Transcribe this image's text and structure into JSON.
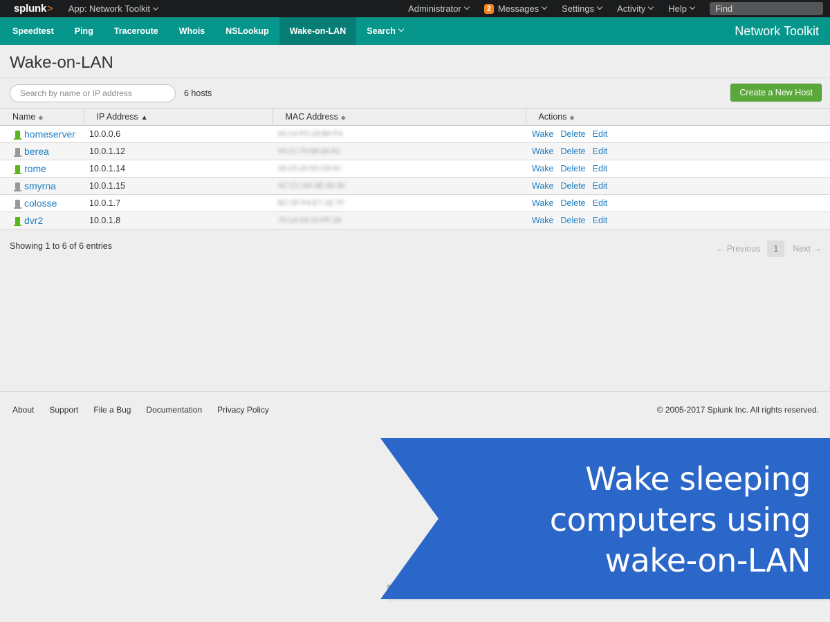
{
  "topbar": {
    "logo": "splunk",
    "logo_mark": ">",
    "app_menu": "App: Network Toolkit",
    "user": "Administrator",
    "messages_count": "2",
    "messages": "Messages",
    "settings": "Settings",
    "activity": "Activity",
    "help": "Help",
    "find_placeholder": "Find"
  },
  "nav": {
    "items": [
      "Speedtest",
      "Ping",
      "Traceroute",
      "Whois",
      "NSLookup",
      "Wake-on-LAN",
      "Search"
    ],
    "active": "Wake-on-LAN",
    "app_title": "Network Toolkit"
  },
  "page": {
    "title": "Wake-on-LAN",
    "search_placeholder": "Search by name or IP address",
    "host_count": "6 hosts",
    "new_host_button": "Create a New Host"
  },
  "table": {
    "columns": [
      "Name",
      "IP Address",
      "MAC Address",
      "Actions"
    ],
    "rows": [
      {
        "name": "homeserver",
        "ip": "10.0.0.6",
        "mac": "00:14:FD:18:B0:F4",
        "online": true
      },
      {
        "name": "berea",
        "ip": "10.0.1.12",
        "mac": "00:21:70:08:3A:61",
        "online": false
      },
      {
        "name": "rome",
        "ip": "10.0.1.14",
        "mac": "00:23:24:55:C8:4C",
        "online": true
      },
      {
        "name": "smyrna",
        "ip": "10.0.1.15",
        "mac": "4C:CC:6A:4E:40:30",
        "online": false
      },
      {
        "name": "colosse",
        "ip": "10.0.1.7",
        "mac": "BC:5F:F4:E7:1E:7F",
        "online": false
      },
      {
        "name": "dvr2",
        "ip": "10.0.1.8",
        "mac": "70:1A:04:10:FF:28",
        "online": true
      }
    ],
    "actions": {
      "wake": "Wake",
      "delete": "Delete",
      "edit": "Edit"
    },
    "status_colors": {
      "online": "#5bb51f",
      "offline": "#999999"
    }
  },
  "pagination": {
    "showing": "Showing 1 to 6 of 6 entries",
    "previous": "← Previous",
    "page": "1",
    "next": "Next →"
  },
  "footer": {
    "links": [
      "About",
      "Support",
      "File a Bug",
      "Documentation",
      "Privacy Policy"
    ],
    "copyright": "© 2005-2017 Splunk Inc. All rights reserved."
  },
  "banner": {
    "line1": "Wake sleeping",
    "line2": "computers using",
    "line3": "wake-on-LAN",
    "color": "#2b66c9"
  }
}
